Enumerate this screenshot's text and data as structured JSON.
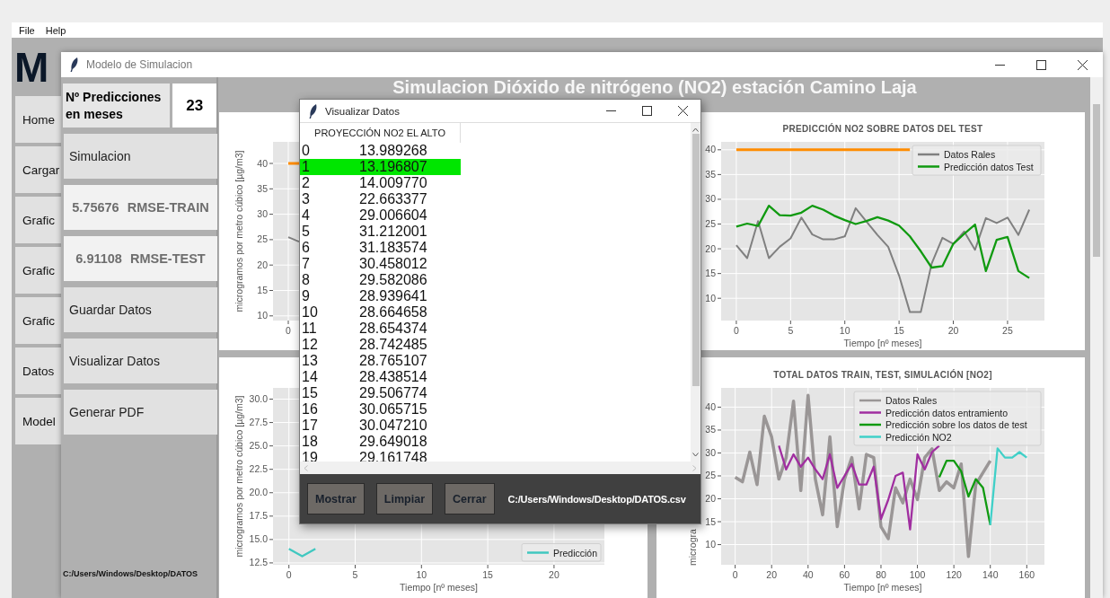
{
  "app_window": {
    "menu": [
      "File",
      "Help"
    ],
    "heading": "M",
    "nav": [
      "Home",
      "Cargar",
      "Grafic",
      "Grafic",
      "Grafic",
      "Datos",
      "Model"
    ]
  },
  "main_window": {
    "title": "Modelo de Simulacion",
    "predictions": {
      "label": "Nº Predicciones en meses",
      "value": "23"
    },
    "sidebar": [
      {
        "kind": "button",
        "label": "Simulacion"
      },
      {
        "kind": "metric",
        "value": "5.75676",
        "label": "RMSE-TRAIN"
      },
      {
        "kind": "metric",
        "value": "6.91108",
        "label": "RMSE-TEST"
      },
      {
        "kind": "button",
        "label": "Guardar Datos"
      },
      {
        "kind": "button",
        "label": "Visualizar Datos"
      },
      {
        "kind": "button",
        "label": "Generar PDF"
      }
    ],
    "file_path": "C:/Users/Windows/Desktop/DATOS",
    "heading": "Simulacion Dióxido de nitrógeno (NO2) estación Camino Laja",
    "charts": [
      {
        "ylabel": "microgramos por metro cúbico [µg/m3]",
        "ytick_labels": [
          "40",
          "35",
          "30",
          "25",
          "20",
          "15",
          "10"
        ],
        "xtick_labels": [
          "0"
        ]
      },
      {
        "chart_data": {
          "type": "line",
          "grid": true,
          "legend": true,
          "title": "PREDICCIÓN NO2 SOBRE DATOS DEL TEST",
          "xlabel": "Tiempo [nº meses]",
          "x": [
            0,
            1,
            2,
            3,
            4,
            5,
            6,
            7,
            8,
            9,
            10,
            11,
            12,
            13,
            14,
            15,
            16,
            17,
            18,
            19,
            20,
            21,
            22,
            23,
            24,
            25,
            26,
            27
          ],
          "xlim": [
            -1.4,
            28.4
          ],
          "ylim": [
            5.5,
            41.6
          ],
          "xticks": [
            {
              "value": 0,
              "label": "0"
            },
            {
              "value": 5,
              "label": "5"
            },
            {
              "value": 10,
              "label": "10"
            },
            {
              "value": 15,
              "label": "15"
            },
            {
              "value": 20,
              "label": "20"
            },
            {
              "value": 25,
              "label": "25"
            }
          ],
          "yticks": [
            {
              "value": 10,
              "label": "10"
            },
            {
              "value": 15,
              "label": "15"
            },
            {
              "value": 20,
              "label": "20"
            },
            {
              "value": 25,
              "label": "25"
            },
            {
              "value": 30,
              "label": "30"
            },
            {
              "value": 35,
              "label": "35"
            },
            {
              "value": 40,
              "label": "40"
            }
          ],
          "series": [
            {
              "color": "#ff8c00",
              "values": [
                40,
                40,
                40,
                40,
                40,
                40,
                40,
                40,
                40,
                40,
                40,
                40,
                40,
                40,
                40,
                40,
                40,
                null,
                null,
                null,
                null,
                null,
                null,
                null,
                null,
                null,
                null,
                null
              ]
            },
            {
              "name": "Datos Rales",
              "color": "#808080",
              "values": [
                20.7,
                18.1,
                25.6,
                18.1,
                20.4,
                22.1,
                26.3,
                22.9,
                21.9,
                21.9,
                22.5,
                28.2,
                25.5,
                22.8,
                20.4,
                14.6,
                7.2,
                7.2,
                17.0,
                22.2,
                21.0,
                23.5,
                19.8,
                26.2,
                25.2,
                26.3,
                22.8,
                27.9
              ]
            },
            {
              "name": "Predicción datos Test",
              "color": "#109a10",
              "values": [
                24.5,
                25.1,
                24.6,
                28.7,
                26.8,
                26.7,
                27.3,
                28.7,
                27.9,
                26.7,
                25.8,
                25.0,
                25.6,
                26.4,
                25.7,
                24.7,
                22.5,
                19.5,
                16.2,
                16.5,
                21.0,
                23.0,
                24.9,
                15.5,
                21.8,
                22.4,
                15.5,
                14.1
              ]
            }
          ]
        }
      },
      {
        "chart_data": {
          "type": "line",
          "grid": true,
          "legend": true,
          "xlabel": "Tiempo [nº meses]",
          "ylabel": "microgramos por metro cúbico [µg/m3]",
          "x": [
            0,
            1,
            2
          ],
          "xlim": [
            -1.2,
            23.8
          ],
          "ylim": [
            12.3,
            31.2
          ],
          "xticks": [
            {
              "value": 0,
              "label": "0"
            },
            {
              "value": 5,
              "label": "5"
            },
            {
              "value": 10,
              "label": "10"
            },
            {
              "value": 15,
              "label": "15"
            },
            {
              "value": 20,
              "label": "20"
            }
          ],
          "yticks": [
            {
              "value": 12.5,
              "label": "12.5"
            },
            {
              "value": 15,
              "label": "15.0"
            },
            {
              "value": 17.5,
              "label": "17.5"
            },
            {
              "value": 20,
              "label": "20.0"
            },
            {
              "value": 22.5,
              "label": "22.5"
            },
            {
              "value": 25,
              "label": "25.0"
            },
            {
              "value": 27.5,
              "label": "27.5"
            },
            {
              "value": 30,
              "label": "30.0"
            }
          ],
          "series": [
            {
              "name": "Predicción",
              "color": "#40c8c0",
              "values": [
                14.0,
                13.2,
                14.0
              ]
            }
          ]
        }
      },
      {
        "chart_data": {
          "type": "line",
          "grid": true,
          "legend": true,
          "title": "TOTAL DATOS TRAIN, TEST, SIMULACIÓN [NO2]",
          "xlabel": "Tiempo [nº meses]",
          "ylabel": "microgra",
          "x": [
            0,
            4,
            8,
            12,
            16,
            20,
            24,
            28,
            32,
            36,
            40,
            44,
            48,
            52,
            56,
            60,
            64,
            68,
            72,
            76,
            80,
            84,
            88,
            92,
            96,
            100,
            104,
            108,
            112,
            116,
            120,
            124,
            128,
            132,
            136,
            140,
            144,
            148,
            152,
            156,
            160
          ],
          "xlim": [
            -7.7,
            169.7
          ],
          "ylim": [
            5.6,
            44.2
          ],
          "xticks": [
            {
              "value": 0,
              "label": "0"
            },
            {
              "value": 20,
              "label": "20"
            },
            {
              "value": 40,
              "label": "40"
            },
            {
              "value": 60,
              "label": "60"
            },
            {
              "value": 80,
              "label": "80"
            },
            {
              "value": 100,
              "label": "100"
            },
            {
              "value": 120,
              "label": "120"
            },
            {
              "value": 140,
              "label": "140"
            },
            {
              "value": 160,
              "label": "160"
            }
          ],
          "yticks": [
            {
              "value": 10,
              "label": "10"
            },
            {
              "value": 15,
              "label": "15"
            },
            {
              "value": 20,
              "label": "20"
            },
            {
              "value": 25,
              "label": "25"
            },
            {
              "value": 30,
              "label": "30"
            },
            {
              "value": 35,
              "label": "35"
            },
            {
              "value": 40,
              "label": "40"
            }
          ],
          "series": [
            {
              "name": "Datos Rales",
              "color": "#9a9696",
              "values": [
                24.7,
                23.7,
                30.2,
                23.1,
                38,
                33.5,
                24.3,
                29,
                41.3,
                21.8,
                42.6,
                24.3,
                16.5,
                33.5,
                13.9,
                24.3,
                29,
                17.8,
                29.7,
                29,
                13.9,
                11.3,
                22.4,
                19.1,
                24.3,
                19.8,
                29,
                30.9,
                21.8,
                23.7,
                22.4,
                27.6,
                7.4,
                23.1,
                25.7,
                28.3,
                null,
                null,
                null,
                null,
                null
              ]
            },
            {
              "name": "Predicción datos entramiento",
              "color": "#a02ea0",
              "values": [
                null,
                null,
                null,
                null,
                null,
                null,
                31.6,
                26.4,
                29.7,
                27,
                29,
                26.4,
                24.3,
                29.7,
                22.4,
                25,
                27.6,
                23.1,
                23.1,
                27,
                15.6,
                19.8,
                25,
                25.7,
                13.3,
                29.7,
                26.4,
                30.2,
                31.6,
                null,
                null,
                null,
                null,
                null,
                null,
                null,
                null,
                null,
                null,
                null,
                null
              ]
            },
            {
              "name": "Predicción sobre los datos de test",
              "color": "#109a10",
              "values": [
                null,
                null,
                null,
                null,
                null,
                null,
                null,
                null,
                null,
                null,
                null,
                null,
                null,
                null,
                null,
                null,
                null,
                null,
                null,
                null,
                null,
                null,
                null,
                null,
                null,
                null,
                null,
                null,
                24.7,
                28.3,
                28.3,
                26,
                20.5,
                24.3,
                22.4,
                14.3,
                null,
                null,
                null,
                null,
                null
              ]
            },
            {
              "name": "Predicción NO2",
              "color": "#40d0c8",
              "values": [
                null,
                null,
                null,
                null,
                null,
                null,
                null,
                null,
                null,
                null,
                null,
                null,
                null,
                null,
                null,
                null,
                null,
                null,
                null,
                null,
                null,
                null,
                null,
                null,
                null,
                null,
                null,
                null,
                null,
                null,
                null,
                null,
                null,
                null,
                null,
                14.3,
                31,
                29,
                29,
                30.2,
                29
              ]
            }
          ]
        }
      }
    ]
  },
  "dialog": {
    "title": "Visualizar Datos",
    "table": {
      "columns": [
        "PROYECCIÓN NO2 EL ALTO"
      ],
      "rows": [
        {
          "index": "0",
          "value": "13.989268",
          "selected": false
        },
        {
          "index": "1",
          "value": "13.196807",
          "selected": true
        },
        {
          "index": "2",
          "value": "14.009770",
          "selected": false
        },
        {
          "index": "3",
          "value": "22.663377",
          "selected": false
        },
        {
          "index": "4",
          "value": "29.006604",
          "selected": false
        },
        {
          "index": "5",
          "value": "31.212001",
          "selected": false
        },
        {
          "index": "6",
          "value": "31.183574",
          "selected": false
        },
        {
          "index": "7",
          "value": "30.458012",
          "selected": false
        },
        {
          "index": "8",
          "value": "29.582086",
          "selected": false
        },
        {
          "index": "9",
          "value": "28.939641",
          "selected": false
        },
        {
          "index": "10",
          "value": "28.664658",
          "selected": false
        },
        {
          "index": "11",
          "value": "28.654374",
          "selected": false
        },
        {
          "index": "12",
          "value": "28.742485",
          "selected": false
        },
        {
          "index": "13",
          "value": "28.765107",
          "selected": false
        },
        {
          "index": "14",
          "value": "28.438514",
          "selected": false
        },
        {
          "index": "15",
          "value": "29.506774",
          "selected": false
        },
        {
          "index": "16",
          "value": "30.065715",
          "selected": false
        },
        {
          "index": "17",
          "value": "30.047210",
          "selected": false
        },
        {
          "index": "18",
          "value": "29.649018",
          "selected": false
        },
        {
          "index": "19",
          "value": "29.161748",
          "selected": false
        }
      ]
    },
    "buttons": [
      "Mostrar",
      "Limpiar",
      "Cerrar"
    ],
    "file_path": "C:/Users/Windows/Desktop/DATOS.csv"
  }
}
